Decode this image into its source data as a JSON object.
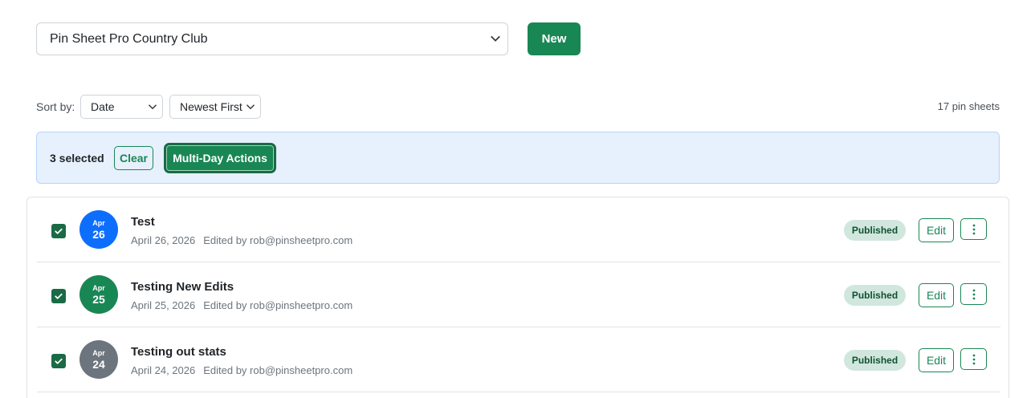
{
  "header": {
    "course_select_value": "Pin Sheet Pro Country Club",
    "new_button_label": "New"
  },
  "sort": {
    "label": "Sort by:",
    "field_value": "Date",
    "order_value": "Newest First"
  },
  "count_text": "17 pin sheets",
  "selection": {
    "count_text": "3 selected",
    "clear_label": "Clear",
    "multi_day_label": "Multi-Day Actions"
  },
  "pin_sheets": [
    {
      "month": "Apr",
      "day": "26",
      "title": "Test",
      "date": "April 26, 2026",
      "editor": "Edited by rob@pinsheetpro.com",
      "status": "Published",
      "edit_label": "Edit",
      "checked": true,
      "circle_color": "#0d6efd"
    },
    {
      "month": "Apr",
      "day": "25",
      "title": "Testing New Edits",
      "date": "April 25, 2026",
      "editor": "Edited by rob@pinsheetpro.com",
      "status": "Published",
      "edit_label": "Edit",
      "checked": true,
      "circle_color": "#198754"
    },
    {
      "month": "Apr",
      "day": "24",
      "title": "Testing out stats",
      "date": "April 24, 2026",
      "editor": "Edited by rob@pinsheetpro.com",
      "status": "Published",
      "edit_label": "Edit",
      "checked": true,
      "circle_color": "#6c757d"
    }
  ],
  "colors": {
    "primary": "#198754",
    "selection_bg": "#e7f0fd",
    "badge_bg": "#d1e7dd"
  }
}
